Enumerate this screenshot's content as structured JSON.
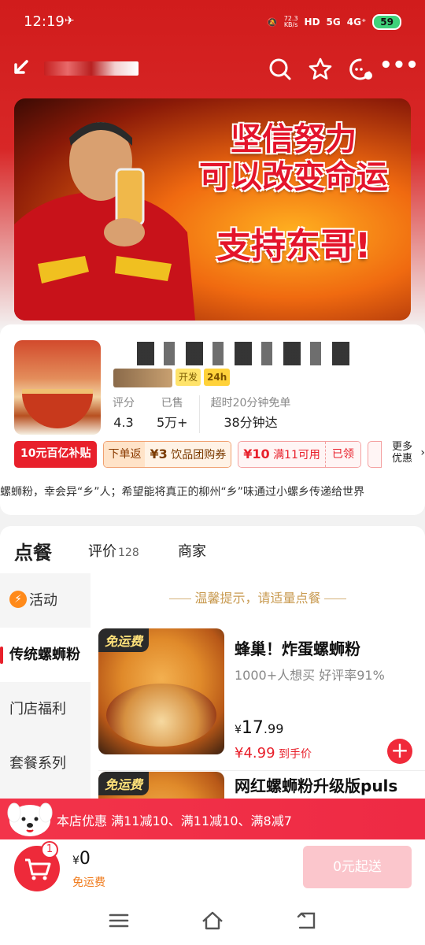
{
  "status_bar": {
    "time": "12:19",
    "net_speed": "72.3\nKB/s",
    "battery": "59",
    "sig1": "HD",
    "sig2": "5G",
    "sig3": "4G⁺"
  },
  "header": {
    "icons": [
      "back-icon",
      "search-icon",
      "star-icon",
      "service-icon",
      "more-icon"
    ]
  },
  "banner": {
    "line1": "坚信努力",
    "line2": "可以改变命运",
    "line3": "支持东哥!"
  },
  "store": {
    "tag_open": "开发",
    "tag_hours": "24h",
    "stats": [
      {
        "label": "评分",
        "value": "4.3"
      },
      {
        "label": "已售",
        "value": "5万+"
      },
      {
        "label": "超时20分钟免单",
        "value": "38分钟达"
      }
    ],
    "coupons": {
      "subsidy": "10元百亿补贴",
      "order_return_label": "下单返",
      "order_return_value": "¥3",
      "order_return_desc": "饮品团购券",
      "discount_value": "¥10",
      "discount_desc": "满11可用",
      "discount_status": "已领",
      "more_line1": "更多",
      "more_line2": "优惠"
    },
    "slogan": "螺蛳粉，幸会异“乡”人；希望能将真正的柳州“乡”味通过小螺乡传递给世界"
  },
  "tabs": {
    "order": "点餐",
    "review": "评价",
    "review_count": "128",
    "merchant": "商家"
  },
  "sidebar": {
    "items": [
      {
        "label": "活动"
      },
      {
        "label": "传统螺蛳粉"
      },
      {
        "label": "门店福利"
      },
      {
        "label": "套餐系列"
      }
    ]
  },
  "menu": {
    "tip": "温馨提示，请适量点餐",
    "items": [
      {
        "badge": "免运费",
        "title": "蜂巢！炸蛋螺蛳粉",
        "subtitle": "1000+人想买  好评率91%",
        "price_int": "17",
        "price_dec": ".99",
        "hand_price": "¥4.99",
        "hand_price_label": "到手价"
      },
      {
        "badge": "免运费",
        "title": "网红螺蛳粉升级版puls",
        "subtitle": "",
        "price_int": "",
        "price_dec": "",
        "hand_price": "",
        "hand_price_label": ""
      }
    ]
  },
  "promo": {
    "text": "本店优惠  满11减10、满11减10、满8减7"
  },
  "cart": {
    "badge_count": "1",
    "price": "0",
    "free_delivery": "免运费",
    "checkout_label": "0元起送"
  },
  "colors": {
    "brand_red": "#e8202b",
    "header_red": "#d11c1c",
    "tip_gold": "#c89a50"
  }
}
